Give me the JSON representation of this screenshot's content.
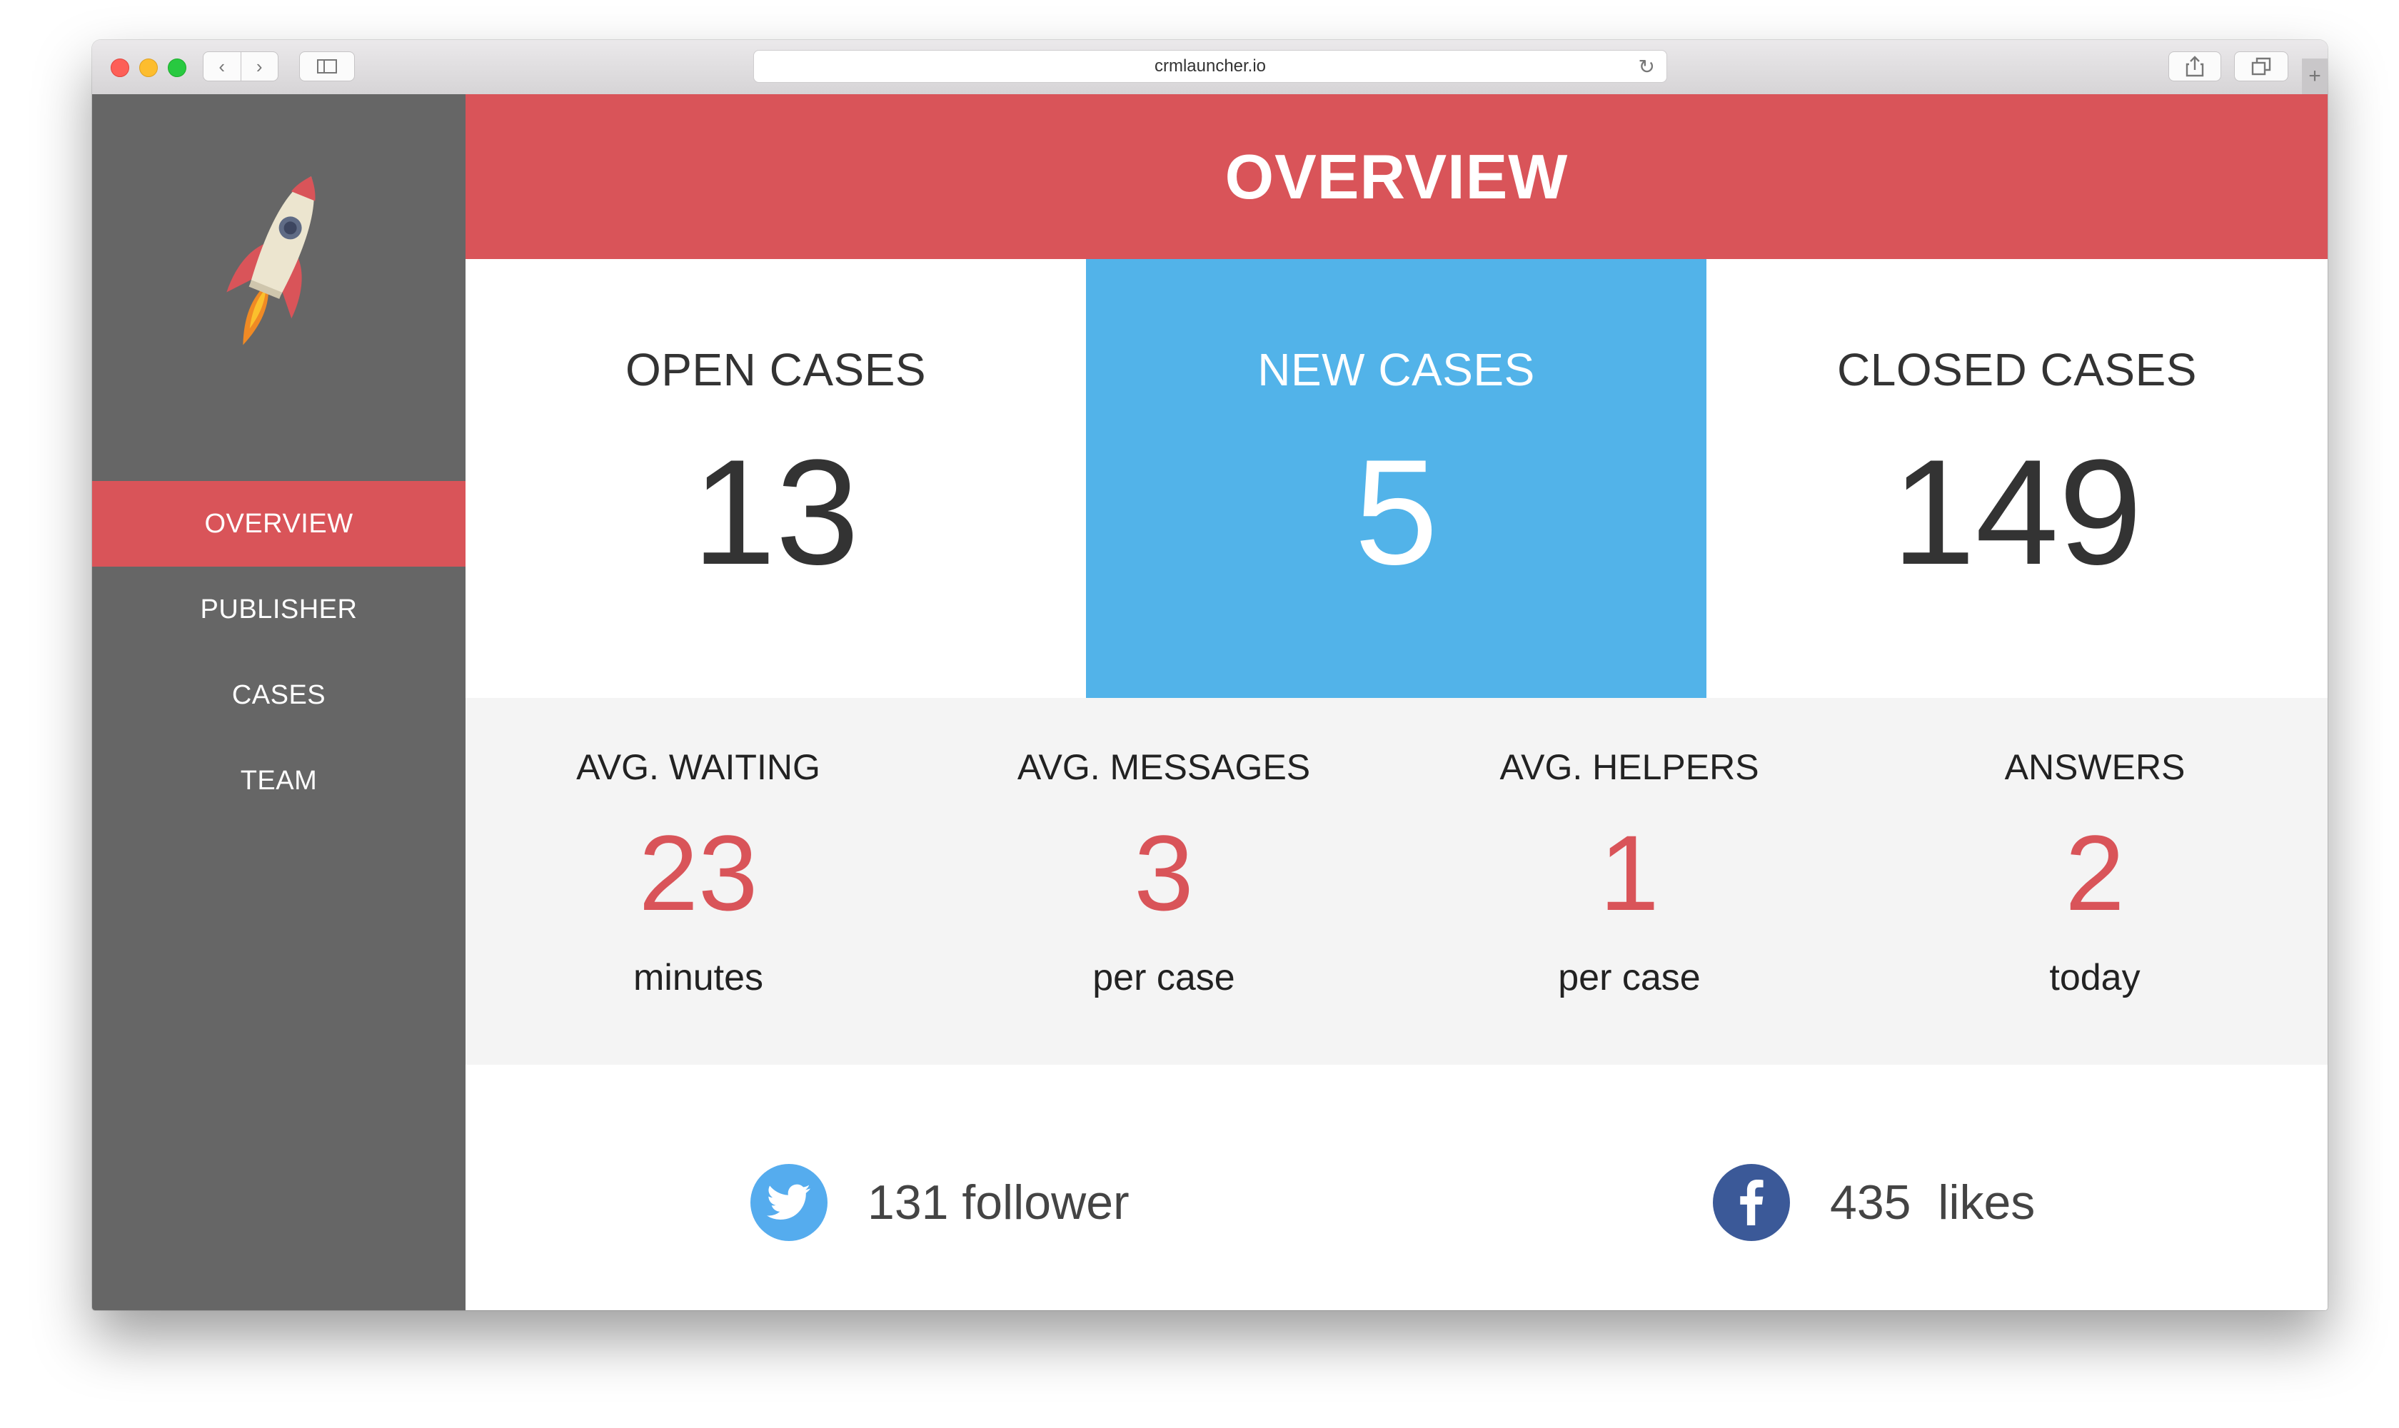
{
  "browser": {
    "url": "crmlauncher.io",
    "back_icon": "chevron-left-icon",
    "forward_icon": "chevron-right-icon",
    "reload_icon": "reload-icon",
    "share_icon": "share-icon",
    "tabs_icon": "tabs-icon",
    "new_tab_label": "+"
  },
  "sidebar": {
    "logo": "rocket-icon",
    "items": [
      {
        "label": "OVERVIEW",
        "active": true
      },
      {
        "label": "PUBLISHER",
        "active": false
      },
      {
        "label": "CASES",
        "active": false
      },
      {
        "label": "TEAM",
        "active": false
      }
    ]
  },
  "header": {
    "title": "OVERVIEW"
  },
  "cards": [
    {
      "title": "OPEN CASES",
      "value": "13"
    },
    {
      "title": "NEW CASES",
      "value": "5"
    },
    {
      "title": "CLOSED CASES",
      "value": "149"
    }
  ],
  "stats": [
    {
      "label": "AVG. WAITING",
      "value": "23",
      "unit": "minutes"
    },
    {
      "label": "AVG. MESSAGES",
      "value": "3",
      "unit": "per case"
    },
    {
      "label": "AVG. HELPERS",
      "value": "1",
      "unit": "per case"
    },
    {
      "label": "ANSWERS",
      "value": "2",
      "unit": "today"
    }
  ],
  "social": {
    "twitter": {
      "icon": "twitter-icon",
      "text": "131 follower"
    },
    "facebook": {
      "icon": "facebook-icon",
      "text": "435  likes"
    }
  },
  "colors": {
    "accent_red": "#d95459",
    "sidebar_gray": "#666666",
    "card_blue": "#52b3e9",
    "twitter_blue": "#55acee",
    "facebook_blue": "#3b5998"
  }
}
